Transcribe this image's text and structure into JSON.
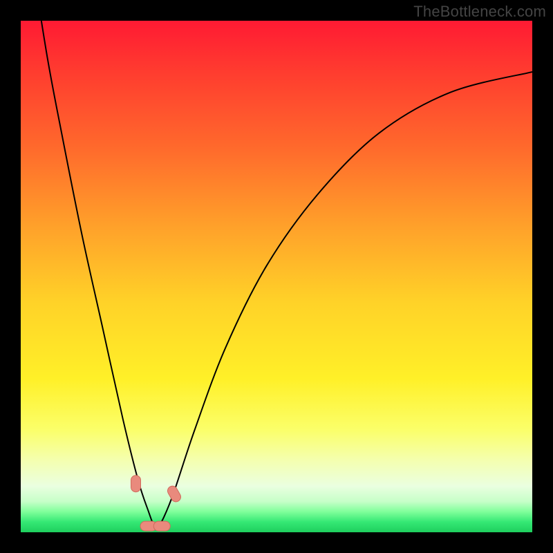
{
  "attribution": "TheBottleneck.com",
  "colors": {
    "frame": "#000000",
    "curve": "#000000",
    "marker_fill": "#e98a7d",
    "marker_stroke": "#d06a5c"
  },
  "chart_data": {
    "type": "line",
    "title": "",
    "xlabel": "",
    "ylabel": "",
    "xlim": [
      0,
      100
    ],
    "ylim": [
      0,
      100
    ],
    "note": "Background is a vertical gradient from red (top, ~100) through orange/yellow to green (bottom, ~0). Curve is a V-shaped function with minimum near x≈26, y≈0, steep left arm and shallow right arm.",
    "series": [
      {
        "name": "bottleneck-curve",
        "x": [
          0,
          2,
          5,
          8,
          12,
          16,
          20,
          23,
          25,
          26,
          27,
          28,
          30,
          34,
          40,
          48,
          58,
          70,
          84,
          100
        ],
        "values": [
          132,
          114,
          94,
          78,
          58,
          40,
          22,
          10,
          4,
          1.5,
          1.5,
          3,
          8,
          20,
          36,
          52,
          66,
          78,
          86,
          90
        ]
      }
    ],
    "markers": [
      {
        "x": 22.5,
        "y": 9.5,
        "shape": "pill-vertical"
      },
      {
        "x": 25.0,
        "y": 1.2,
        "shape": "pill-horizontal"
      },
      {
        "x": 27.6,
        "y": 1.2,
        "shape": "pill-horizontal"
      },
      {
        "x": 30.0,
        "y": 7.5,
        "shape": "pill-diagonal"
      }
    ],
    "gradient_stops": [
      {
        "pos": 0,
        "color": "#ff1a33"
      },
      {
        "pos": 25,
        "color": "#ff6a2c"
      },
      {
        "pos": 55,
        "color": "#ffd228"
      },
      {
        "pos": 80,
        "color": "#fbff6a"
      },
      {
        "pos": 96,
        "color": "#7fff9a"
      },
      {
        "pos": 100,
        "color": "#1ecf5e"
      }
    ]
  }
}
